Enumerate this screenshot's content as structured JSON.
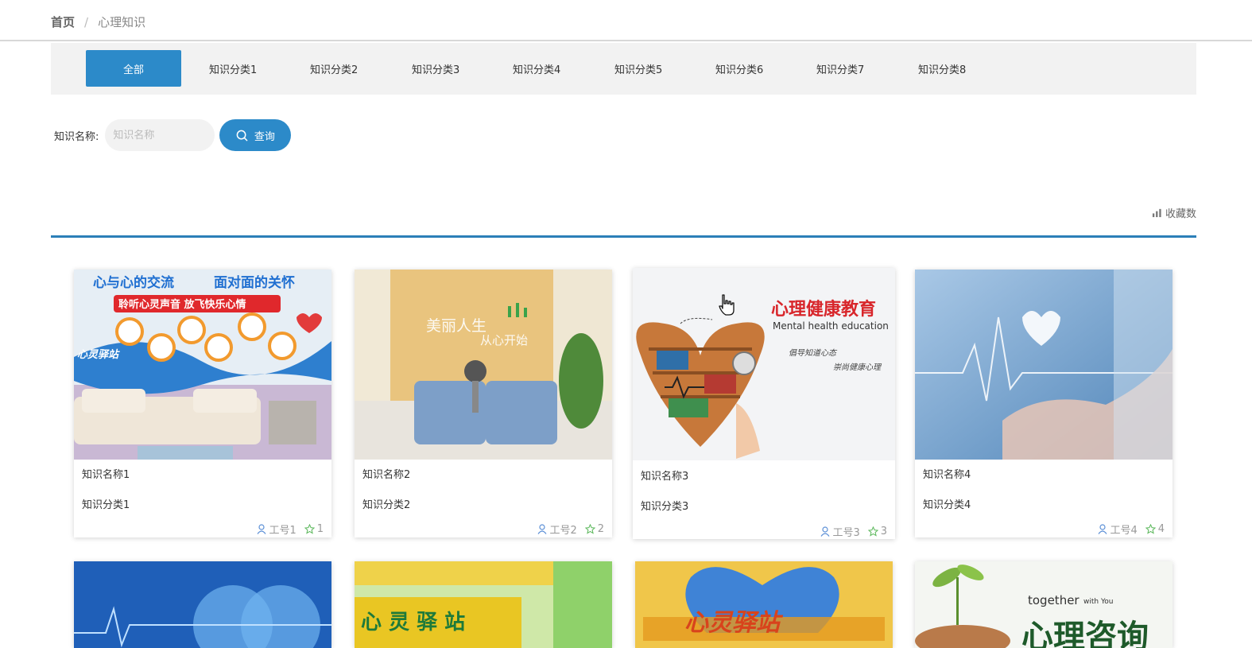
{
  "breadcrumb": {
    "home": "首页",
    "separator": "/",
    "current": "心理知识"
  },
  "categories": [
    {
      "label": "全部",
      "active": true
    },
    {
      "label": "知识分类1"
    },
    {
      "label": "知识分类2"
    },
    {
      "label": "知识分类3"
    },
    {
      "label": "知识分类4"
    },
    {
      "label": "知识分类5"
    },
    {
      "label": "知识分类6"
    },
    {
      "label": "知识分类7"
    },
    {
      "label": "知识分类8"
    }
  ],
  "search": {
    "label": "知识名称:",
    "placeholder": "知识名称",
    "value": "",
    "button_label": "查询"
  },
  "sort": {
    "label": "收藏数",
    "icon": "bar-chart-icon"
  },
  "cards": [
    {
      "title": "知识名称1",
      "category": "知识分类1",
      "author": "工号1",
      "favorites": "1",
      "image_texts": [
        "心与心的交流",
        "面对面的关怀",
        "聆听心灵声音 放飞快乐心情",
        "心灵驿站"
      ]
    },
    {
      "title": "知识名称2",
      "category": "知识分类2",
      "author": "工号2",
      "favorites": "2",
      "image_texts": [
        "美丽人生",
        "从心开始"
      ]
    },
    {
      "title": "知识名称3",
      "category": "知识分类3",
      "author": "工号3",
      "favorites": "3",
      "image_texts": [
        "心理健康教育",
        "Mental health education",
        "倡导知道心态",
        "崇尚健康心理"
      ]
    },
    {
      "title": "知识名称4",
      "category": "知识分类4",
      "author": "工号4",
      "favorites": "4",
      "image_texts": []
    },
    {
      "image_texts": []
    },
    {
      "image_texts": [
        "心 灵 驿 站"
      ]
    },
    {
      "image_texts": [
        "心灵驿站"
      ]
    },
    {
      "image_texts": [
        "together",
        "with You",
        "心理咨询"
      ]
    }
  ],
  "colors": {
    "accent": "#2c8ac9",
    "divider": "#2c7fb8",
    "bar_bg": "#f2f2f2"
  }
}
